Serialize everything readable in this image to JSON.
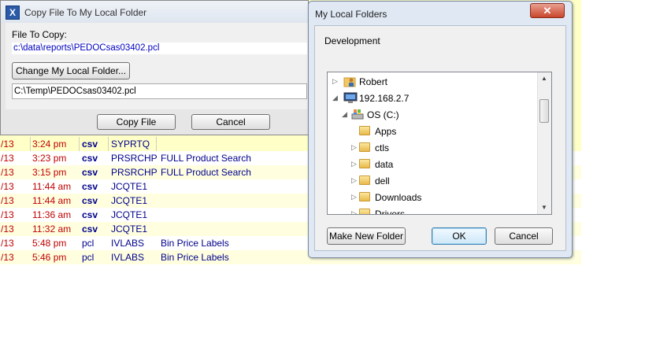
{
  "copy_dialog": {
    "title": "Copy File To My Local Folder",
    "app_icon": "X",
    "file_to_copy_label": "File To Copy:",
    "file_path": "c:\\data\\reports\\PEDOCsas03402.pcl",
    "change_folder_button": "Change My Local Folder...",
    "local_path": "C:\\Temp\\PEDOCsas03402.pcl",
    "copy_button": "Copy File",
    "cancel_button": "Cancel"
  },
  "folder_dialog": {
    "title": "My Local Folders",
    "close_label": "✕",
    "current_folder": "Development",
    "tree": [
      {
        "label": "Robert",
        "arrow": "▷",
        "icon": "user-folder-icon"
      },
      {
        "label": "192.168.2.7",
        "arrow": "◢",
        "icon": "computer-icon"
      },
      {
        "label": "OS (C:)",
        "arrow": "◢",
        "icon": "drive-icon"
      },
      {
        "label": "Apps",
        "arrow": "",
        "icon": "folder-icon"
      },
      {
        "label": "ctls",
        "arrow": "▷",
        "icon": "folder-icon"
      },
      {
        "label": "data",
        "arrow": "▷",
        "icon": "folder-icon"
      },
      {
        "label": "dell",
        "arrow": "▷",
        "icon": "folder-icon"
      },
      {
        "label": "Downloads",
        "arrow": "▷",
        "icon": "folder-icon"
      },
      {
        "label": "Drivers",
        "arrow": "▷",
        "icon": "folder-icon"
      }
    ],
    "make_new_folder_button": "Make New Folder",
    "ok_button": "OK",
    "cancel_button": "Cancel"
  },
  "report_rows": [
    {
      "date": "/13",
      "time": "3:24 pm",
      "type": "csv",
      "name": "SYPRTQ",
      "desc": ""
    },
    {
      "date": "/13",
      "time": "3:23 pm",
      "type": "csv",
      "name": "PRSRCHP",
      "desc": "FULL Product Search"
    },
    {
      "date": "/13",
      "time": "3:15 pm",
      "type": "csv",
      "name": "PRSRCHP",
      "desc": "FULL Product Search"
    },
    {
      "date": "/13",
      "time": "11:44 am",
      "type": "csv",
      "name": "JCQTE1",
      "desc": ""
    },
    {
      "date": "/13",
      "time": "11:44 am",
      "type": "csv",
      "name": "JCQTE1",
      "desc": ""
    },
    {
      "date": "/13",
      "time": "11:36 am",
      "type": "csv",
      "name": "JCQTE1",
      "desc": ""
    },
    {
      "date": "/13",
      "time": "11:32 am",
      "type": "csv",
      "name": "JCQTE1",
      "desc": ""
    },
    {
      "date": "/13",
      "time": "5:48 pm",
      "type": "pcl",
      "name": "IVLABS",
      "desc": "Bin Price Labels"
    },
    {
      "date": "/13",
      "time": "5:46 pm",
      "type": "pcl",
      "name": "IVLABS",
      "desc": "Bin Price Labels"
    }
  ]
}
